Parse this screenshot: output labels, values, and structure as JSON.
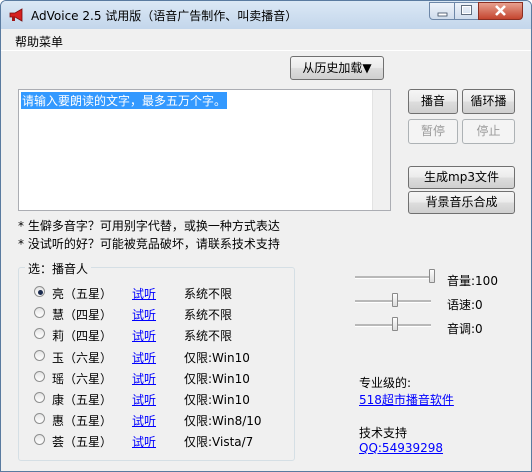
{
  "window": {
    "title": "AdVoice 2.5 试用版（语音广告制作、叫卖播音）",
    "accent": "#3399ff"
  },
  "menu": {
    "help": "帮助菜单"
  },
  "history_button": "从历史加载▼",
  "text_input": {
    "value": "请输入要朗读的文字，最多五万个字。"
  },
  "buttons": {
    "play": "播音",
    "loop_play": "循环播",
    "pause": "暂停",
    "stop": "停止",
    "make_mp3": "生成mp3文件",
    "bg_music": "背景音乐合成"
  },
  "notes": [
    "* 生僻多音字？可用别字代替，或换一种方式表达",
    "* 没试听的好？可能被竞品破坏，请联系技术支持"
  ],
  "voice_group": {
    "title": "选：播音人",
    "voices": [
      {
        "name": "亮（五星）",
        "preview": "试听",
        "requirement": "系统不限",
        "selected": true
      },
      {
        "name": "慧（四星）",
        "preview": "试听",
        "requirement": "系统不限",
        "selected": false
      },
      {
        "name": "莉（四星）",
        "preview": "试听",
        "requirement": "系统不限",
        "selected": false
      },
      {
        "name": "玉（六星）",
        "preview": "试听",
        "requirement": "仅限:Win10",
        "selected": false
      },
      {
        "name": "瑶（六星）",
        "preview": "试听",
        "requirement": "仅限:Win10",
        "selected": false
      },
      {
        "name": "康（五星）",
        "preview": "试听",
        "requirement": "仅限:Win10",
        "selected": false
      },
      {
        "name": "惠（五星）",
        "preview": "试听",
        "requirement": "仅限:Win8/10",
        "selected": false
      },
      {
        "name": "荟（五星）",
        "preview": "试听",
        "requirement": "仅限:Vista/7",
        "selected": false
      }
    ]
  },
  "sliders": {
    "volume": {
      "label": "音量:100",
      "value": 100,
      "max": 100
    },
    "speed": {
      "label": "语速:0",
      "value": 0,
      "min": -10,
      "max": 10
    },
    "pitch": {
      "label": "音调:0",
      "value": 0,
      "min": -10,
      "max": 10
    }
  },
  "info": {
    "pro_label": "专业级的:",
    "pro_link": "518超市播音软件",
    "support_label": "技术支持",
    "support_link": "QQ:54939298"
  }
}
